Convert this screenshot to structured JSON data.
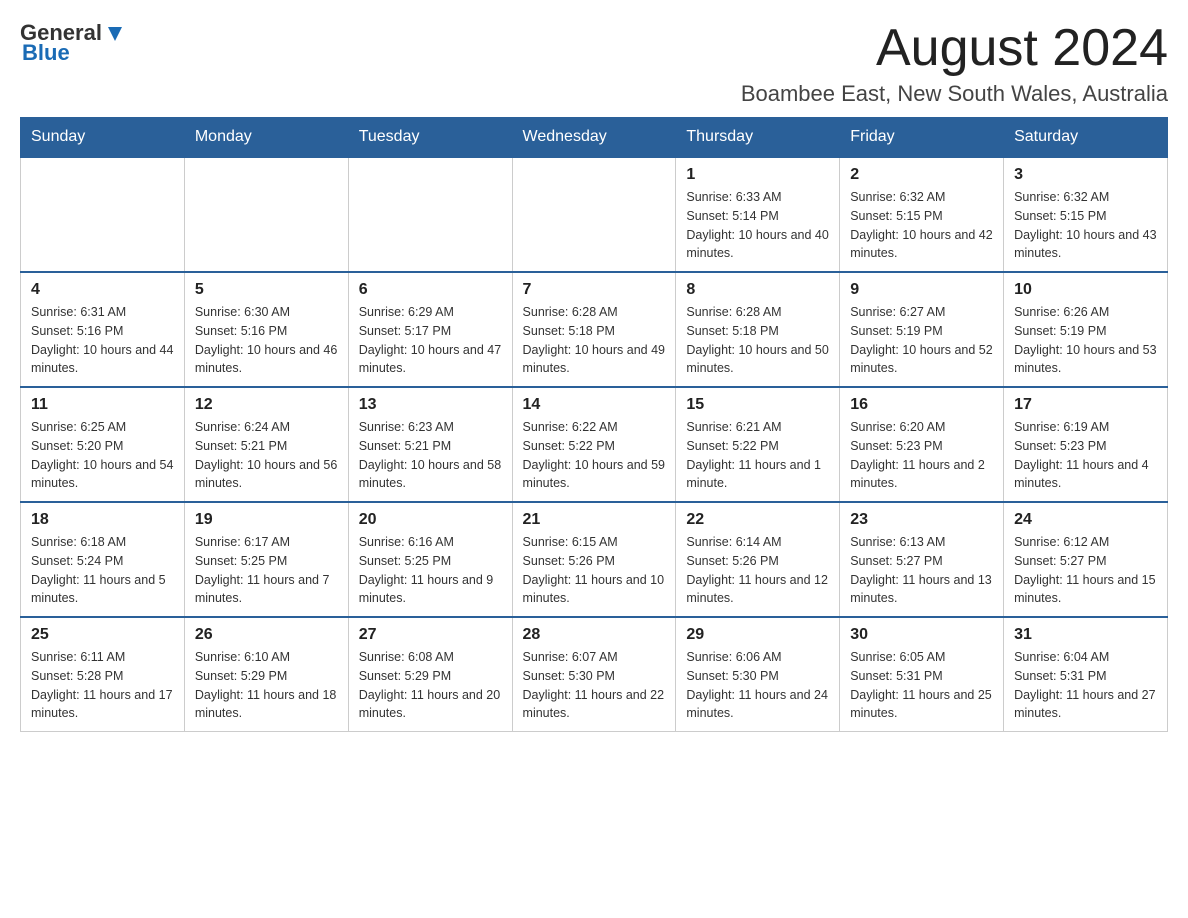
{
  "logo": {
    "general": "General",
    "blue": "Blue"
  },
  "header": {
    "title": "August 2024",
    "subtitle": "Boambee East, New South Wales, Australia"
  },
  "days_of_week": [
    "Sunday",
    "Monday",
    "Tuesday",
    "Wednesday",
    "Thursday",
    "Friday",
    "Saturday"
  ],
  "weeks": [
    {
      "days": [
        {
          "number": "",
          "info": ""
        },
        {
          "number": "",
          "info": ""
        },
        {
          "number": "",
          "info": ""
        },
        {
          "number": "",
          "info": ""
        },
        {
          "number": "1",
          "info": "Sunrise: 6:33 AM\nSunset: 5:14 PM\nDaylight: 10 hours and 40 minutes."
        },
        {
          "number": "2",
          "info": "Sunrise: 6:32 AM\nSunset: 5:15 PM\nDaylight: 10 hours and 42 minutes."
        },
        {
          "number": "3",
          "info": "Sunrise: 6:32 AM\nSunset: 5:15 PM\nDaylight: 10 hours and 43 minutes."
        }
      ]
    },
    {
      "days": [
        {
          "number": "4",
          "info": "Sunrise: 6:31 AM\nSunset: 5:16 PM\nDaylight: 10 hours and 44 minutes."
        },
        {
          "number": "5",
          "info": "Sunrise: 6:30 AM\nSunset: 5:16 PM\nDaylight: 10 hours and 46 minutes."
        },
        {
          "number": "6",
          "info": "Sunrise: 6:29 AM\nSunset: 5:17 PM\nDaylight: 10 hours and 47 minutes."
        },
        {
          "number": "7",
          "info": "Sunrise: 6:28 AM\nSunset: 5:18 PM\nDaylight: 10 hours and 49 minutes."
        },
        {
          "number": "8",
          "info": "Sunrise: 6:28 AM\nSunset: 5:18 PM\nDaylight: 10 hours and 50 minutes."
        },
        {
          "number": "9",
          "info": "Sunrise: 6:27 AM\nSunset: 5:19 PM\nDaylight: 10 hours and 52 minutes."
        },
        {
          "number": "10",
          "info": "Sunrise: 6:26 AM\nSunset: 5:19 PM\nDaylight: 10 hours and 53 minutes."
        }
      ]
    },
    {
      "days": [
        {
          "number": "11",
          "info": "Sunrise: 6:25 AM\nSunset: 5:20 PM\nDaylight: 10 hours and 54 minutes."
        },
        {
          "number": "12",
          "info": "Sunrise: 6:24 AM\nSunset: 5:21 PM\nDaylight: 10 hours and 56 minutes."
        },
        {
          "number": "13",
          "info": "Sunrise: 6:23 AM\nSunset: 5:21 PM\nDaylight: 10 hours and 58 minutes."
        },
        {
          "number": "14",
          "info": "Sunrise: 6:22 AM\nSunset: 5:22 PM\nDaylight: 10 hours and 59 minutes."
        },
        {
          "number": "15",
          "info": "Sunrise: 6:21 AM\nSunset: 5:22 PM\nDaylight: 11 hours and 1 minute."
        },
        {
          "number": "16",
          "info": "Sunrise: 6:20 AM\nSunset: 5:23 PM\nDaylight: 11 hours and 2 minutes."
        },
        {
          "number": "17",
          "info": "Sunrise: 6:19 AM\nSunset: 5:23 PM\nDaylight: 11 hours and 4 minutes."
        }
      ]
    },
    {
      "days": [
        {
          "number": "18",
          "info": "Sunrise: 6:18 AM\nSunset: 5:24 PM\nDaylight: 11 hours and 5 minutes."
        },
        {
          "number": "19",
          "info": "Sunrise: 6:17 AM\nSunset: 5:25 PM\nDaylight: 11 hours and 7 minutes."
        },
        {
          "number": "20",
          "info": "Sunrise: 6:16 AM\nSunset: 5:25 PM\nDaylight: 11 hours and 9 minutes."
        },
        {
          "number": "21",
          "info": "Sunrise: 6:15 AM\nSunset: 5:26 PM\nDaylight: 11 hours and 10 minutes."
        },
        {
          "number": "22",
          "info": "Sunrise: 6:14 AM\nSunset: 5:26 PM\nDaylight: 11 hours and 12 minutes."
        },
        {
          "number": "23",
          "info": "Sunrise: 6:13 AM\nSunset: 5:27 PM\nDaylight: 11 hours and 13 minutes."
        },
        {
          "number": "24",
          "info": "Sunrise: 6:12 AM\nSunset: 5:27 PM\nDaylight: 11 hours and 15 minutes."
        }
      ]
    },
    {
      "days": [
        {
          "number": "25",
          "info": "Sunrise: 6:11 AM\nSunset: 5:28 PM\nDaylight: 11 hours and 17 minutes."
        },
        {
          "number": "26",
          "info": "Sunrise: 6:10 AM\nSunset: 5:29 PM\nDaylight: 11 hours and 18 minutes."
        },
        {
          "number": "27",
          "info": "Sunrise: 6:08 AM\nSunset: 5:29 PM\nDaylight: 11 hours and 20 minutes."
        },
        {
          "number": "28",
          "info": "Sunrise: 6:07 AM\nSunset: 5:30 PM\nDaylight: 11 hours and 22 minutes."
        },
        {
          "number": "29",
          "info": "Sunrise: 6:06 AM\nSunset: 5:30 PM\nDaylight: 11 hours and 24 minutes."
        },
        {
          "number": "30",
          "info": "Sunrise: 6:05 AM\nSunset: 5:31 PM\nDaylight: 11 hours and 25 minutes."
        },
        {
          "number": "31",
          "info": "Sunrise: 6:04 AM\nSunset: 5:31 PM\nDaylight: 11 hours and 27 minutes."
        }
      ]
    }
  ]
}
